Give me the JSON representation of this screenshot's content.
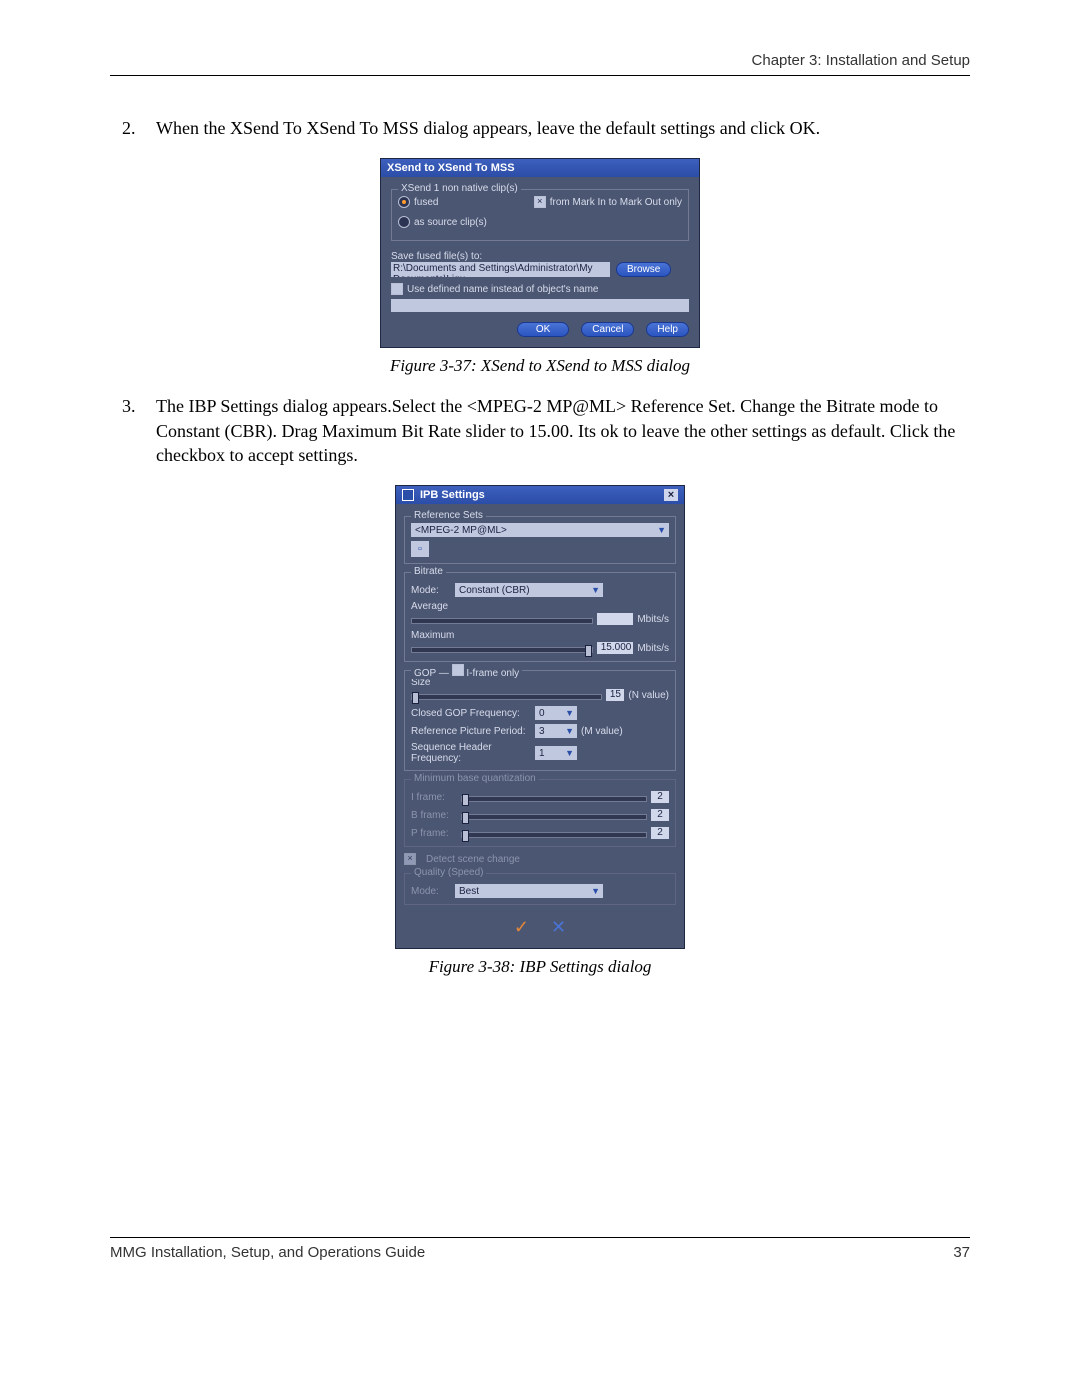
{
  "header": {
    "chapter": "Chapter 3: Installation and Setup"
  },
  "steps": {
    "two": "When the XSend To XSend To MSS dialog appears, leave the default settings and click OK.",
    "three": "The IBP Settings dialog appears.Select the <MPEG-2 MP@ML> Reference Set. Change the Bitrate mode to Constant (CBR). Drag Maximum Bit Rate slider to 15.00. Its ok to leave the other settings as default. Click the checkbox to accept settings."
  },
  "captions": {
    "fig37": "Figure 3-37: XSend to XSend to MSS dialog",
    "fig38": "Figure 3-38: IBP Settings dialog"
  },
  "xsend": {
    "title": "XSend to XSend To MSS",
    "group_nonnative": "XSend 1 non native clip(s)",
    "radio_fused": "fused",
    "radio_source": "as source clip(s)",
    "check_markinout": "from Mark In to Mark Out only",
    "save_label": "Save fused file(s) to:",
    "path": "R:\\Documents and Settings\\Administrator\\My Documents\\Liqu",
    "browse": "Browse",
    "use_defined": "Use defined name instead of object's name",
    "ok": "OK",
    "cancel": "Cancel",
    "help": "Help"
  },
  "ibp": {
    "title": "IPB Settings",
    "ref_sets": "Reference Sets",
    "ref_value": "<MPEG-2 MP@ML>",
    "bitrate": "Bitrate",
    "mode_label": "Mode:",
    "mode_value": "Constant (CBR)",
    "average": "Average",
    "maximum": "Maximum",
    "max_val": "15.000",
    "mbits": "Mbits/s",
    "gop": "GOP",
    "iframe_only": "I-frame only",
    "size": "Size",
    "size_val": "15",
    "n_value": "(N value)",
    "closed_gop": "Closed GOP Frequency:",
    "closed_gop_val": "0",
    "ref_pic": "Reference Picture Period:",
    "ref_pic_val": "3",
    "m_value": "(M value)",
    "seq_hdr": "Sequence Header Frequency:",
    "seq_hdr_val": "1",
    "min_quant": "Minimum base quantization",
    "iframe": "I frame:",
    "bframe": "B frame:",
    "pframe": "P frame:",
    "q_val": "2",
    "detect_scene": "Detect scene change",
    "quality": "Quality (Speed)",
    "quality_mode": "Mode:",
    "quality_value": "Best"
  },
  "footer": {
    "left": "MMG Installation, Setup, and Operations Guide",
    "right": "37"
  }
}
